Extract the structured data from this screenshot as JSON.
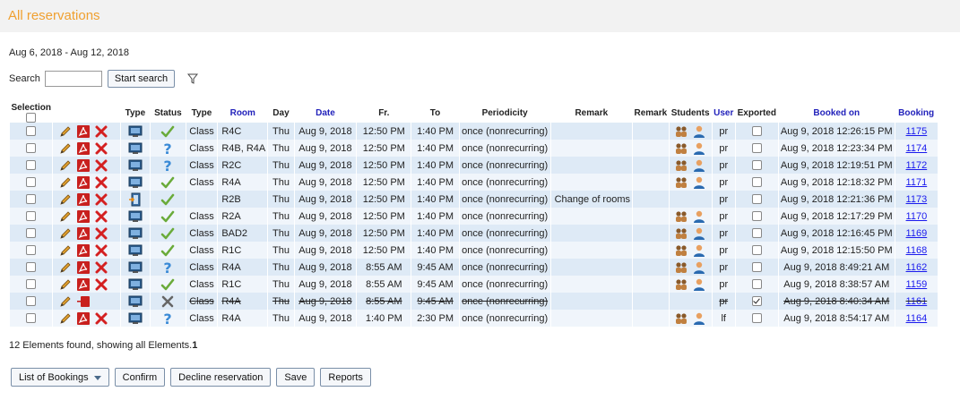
{
  "header": {
    "title": "All reservations"
  },
  "date_range": "Aug 6, 2018 - Aug 12, 2018",
  "search": {
    "label": "Search",
    "value": "",
    "button": "Start search"
  },
  "columns": {
    "selection": "Selection",
    "type1": "Type",
    "status": "Status",
    "type2": "Type",
    "room": "Room",
    "day": "Day",
    "date": "Date",
    "from": "Fr.",
    "to": "To",
    "periodicity": "Periodicity",
    "remark1": "Remark",
    "remark2": "Remark",
    "students": "Students",
    "user": "User",
    "exported": "Exported",
    "booked_on": "Booked on",
    "booking": "Booking"
  },
  "rows": [
    {
      "status": "ok",
      "type": "Class",
      "room": "R4C",
      "day": "Thu",
      "date": "Aug 9, 2018",
      "from": "12:50 PM",
      "to": "1:40 PM",
      "periodicity": "once (nonrecurring)",
      "remark1": "",
      "remark2": "",
      "students": true,
      "user": "pr",
      "exported": false,
      "booked_on": "Aug 9, 2018 12:26:15 PM",
      "booking": "1175",
      "struck": false,
      "icon": "monitor"
    },
    {
      "status": "question",
      "type": "Class",
      "room": "R4B, R4A",
      "day": "Thu",
      "date": "Aug 9, 2018",
      "from": "12:50 PM",
      "to": "1:40 PM",
      "periodicity": "once (nonrecurring)",
      "remark1": "",
      "remark2": "",
      "students": true,
      "user": "pr",
      "exported": false,
      "booked_on": "Aug 9, 2018 12:23:34 PM",
      "booking": "1174",
      "struck": false,
      "icon": "monitor"
    },
    {
      "status": "question",
      "type": "Class",
      "room": "R2C",
      "day": "Thu",
      "date": "Aug 9, 2018",
      "from": "12:50 PM",
      "to": "1:40 PM",
      "periodicity": "once (nonrecurring)",
      "remark1": "",
      "remark2": "",
      "students": true,
      "user": "pr",
      "exported": false,
      "booked_on": "Aug 9, 2018 12:19:51 PM",
      "booking": "1172",
      "struck": false,
      "icon": "monitor"
    },
    {
      "status": "ok",
      "type": "Class",
      "room": "R4A",
      "day": "Thu",
      "date": "Aug 9, 2018",
      "from": "12:50 PM",
      "to": "1:40 PM",
      "periodicity": "once (nonrecurring)",
      "remark1": "",
      "remark2": "",
      "students": true,
      "user": "pr",
      "exported": false,
      "booked_on": "Aug 9, 2018 12:18:32 PM",
      "booking": "1171",
      "struck": false,
      "icon": "monitor"
    },
    {
      "status": "ok",
      "type": "",
      "room": "R2B",
      "day": "Thu",
      "date": "Aug 9, 2018",
      "from": "12:50 PM",
      "to": "1:40 PM",
      "periodicity": "once (nonrecurring)",
      "remark1": "Change of rooms",
      "remark2": "",
      "students": false,
      "user": "pr",
      "exported": false,
      "booked_on": "Aug 9, 2018 12:21:36 PM",
      "booking": "1173",
      "struck": false,
      "icon": "door"
    },
    {
      "status": "ok",
      "type": "Class",
      "room": "R2A",
      "day": "Thu",
      "date": "Aug 9, 2018",
      "from": "12:50 PM",
      "to": "1:40 PM",
      "periodicity": "once (nonrecurring)",
      "remark1": "",
      "remark2": "",
      "students": true,
      "user": "pr",
      "exported": false,
      "booked_on": "Aug 9, 2018 12:17:29 PM",
      "booking": "1170",
      "struck": false,
      "icon": "monitor"
    },
    {
      "status": "ok",
      "type": "Class",
      "room": "BAD2",
      "day": "Thu",
      "date": "Aug 9, 2018",
      "from": "12:50 PM",
      "to": "1:40 PM",
      "periodicity": "once (nonrecurring)",
      "remark1": "",
      "remark2": "",
      "students": true,
      "user": "pr",
      "exported": false,
      "booked_on": "Aug 9, 2018 12:16:45 PM",
      "booking": "1169",
      "struck": false,
      "icon": "monitor"
    },
    {
      "status": "ok",
      "type": "Class",
      "room": "R1C",
      "day": "Thu",
      "date": "Aug 9, 2018",
      "from": "12:50 PM",
      "to": "1:40 PM",
      "periodicity": "once (nonrecurring)",
      "remark1": "",
      "remark2": "",
      "students": true,
      "user": "pr",
      "exported": false,
      "booked_on": "Aug 9, 2018 12:15:50 PM",
      "booking": "1168",
      "struck": false,
      "icon": "monitor"
    },
    {
      "status": "question",
      "type": "Class",
      "room": "R4A",
      "day": "Thu",
      "date": "Aug 9, 2018",
      "from": "8:55 AM",
      "to": "9:45 AM",
      "periodicity": "once (nonrecurring)",
      "remark1": "",
      "remark2": "",
      "students": true,
      "user": "pr",
      "exported": false,
      "booked_on": "Aug 9, 2018 8:49:21 AM",
      "booking": "1162",
      "struck": false,
      "icon": "monitor"
    },
    {
      "status": "ok",
      "type": "Class",
      "room": "R1C",
      "day": "Thu",
      "date": "Aug 9, 2018",
      "from": "8:55 AM",
      "to": "9:45 AM",
      "periodicity": "once (nonrecurring)",
      "remark1": "",
      "remark2": "",
      "students": true,
      "user": "pr",
      "exported": false,
      "booked_on": "Aug 9, 2018 8:38:57 AM",
      "booking": "1159",
      "struck": false,
      "icon": "monitor"
    },
    {
      "status": "declined",
      "type": "Class",
      "room": "R4A",
      "day": "Thu",
      "date": "Aug 9, 2018",
      "from": "8:55 AM",
      "to": "9:45 AM",
      "periodicity": "once (nonrecurring)",
      "remark1": "",
      "remark2": "",
      "students": false,
      "user": "pr",
      "exported": true,
      "booked_on": "Aug 9, 2018 8:40:34 AM",
      "booking": "1161",
      "struck": true,
      "icon": "monitor"
    },
    {
      "status": "question",
      "type": "Class",
      "room": "R4A",
      "day": "Thu",
      "date": "Aug 9, 2018",
      "from": "1:40 PM",
      "to": "2:30 PM",
      "periodicity": "once (nonrecurring)",
      "remark1": "",
      "remark2": "",
      "students": true,
      "user": "lf",
      "exported": false,
      "booked_on": "Aug 9, 2018 8:54:17 AM",
      "booking": "1164",
      "struck": false,
      "icon": "monitor"
    }
  ],
  "footer": {
    "text": "12 Elements found, showing all Elements.",
    "page": "1"
  },
  "buttons": {
    "list": "List of Bookings",
    "confirm": "Confirm",
    "decline": "Decline reservation",
    "save": "Save",
    "reports": "Reports"
  },
  "colors": {
    "accent": "#f0a030",
    "row_odd": "#deeaf6",
    "row_even": "#f0f5fb",
    "link": "#2222bb"
  }
}
